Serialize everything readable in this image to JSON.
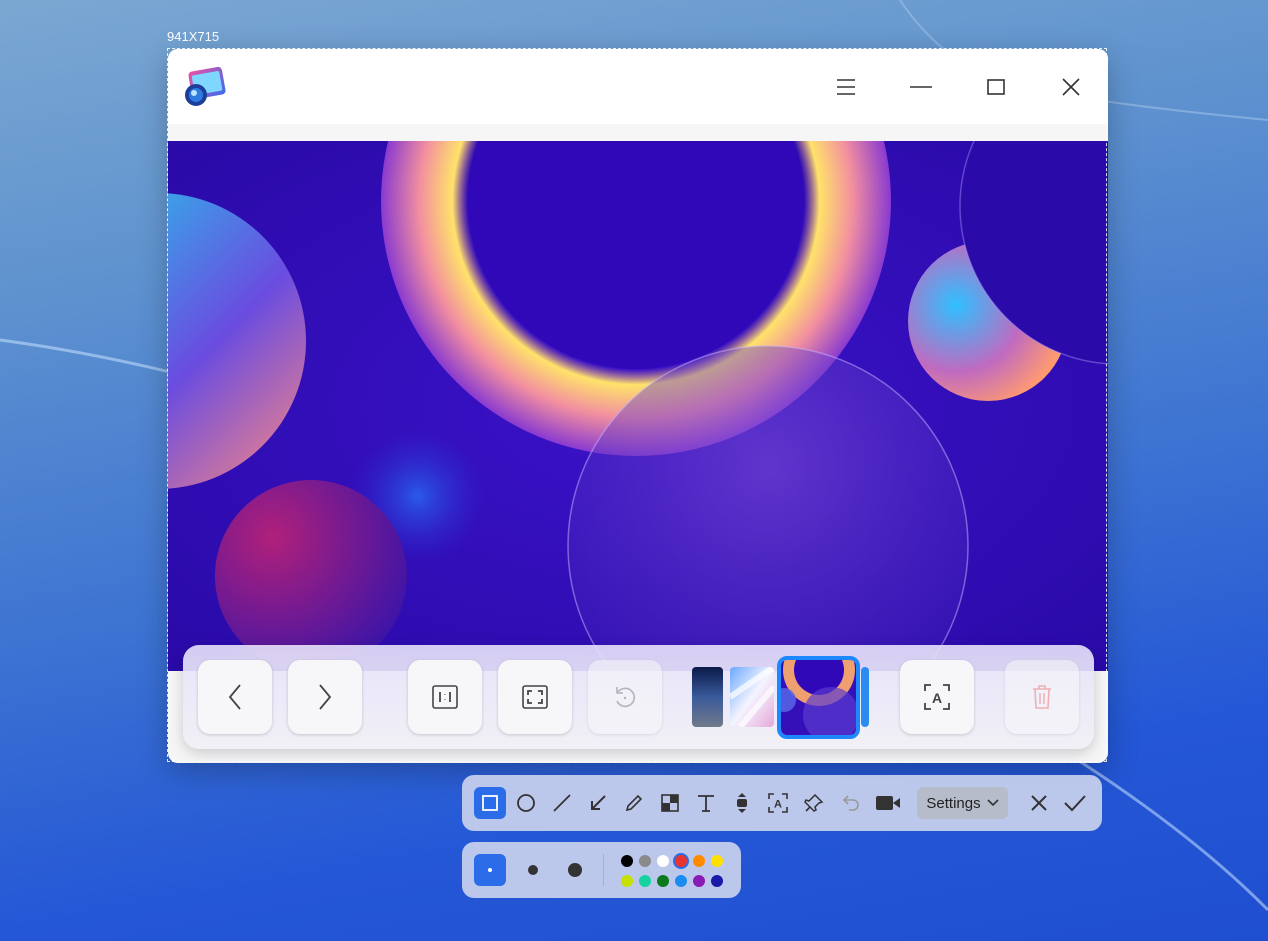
{
  "selection": {
    "size_label": "941X715"
  },
  "window": {
    "app_icon": "image-viewer-icon",
    "title_buttons": [
      "menu-icon",
      "minimize-icon",
      "maximize-icon",
      "close-icon"
    ]
  },
  "viewer_toolbar": {
    "buttons": [
      "previous-icon",
      "next-icon",
      "original-size-icon",
      "fit-window-icon",
      "rotate-icon",
      "ocr-icon",
      "delete-icon"
    ],
    "thumbnails": 4,
    "selected_thumbnail": 3
  },
  "screenshot_toolbar": {
    "tools": [
      "rectangle-icon",
      "ellipse-icon",
      "line-icon",
      "arrow-icon",
      "pen-icon",
      "mosaic-icon",
      "text-icon",
      "scroll-capture-icon",
      "ocr-icon",
      "pin-icon",
      "undo-icon",
      "record-icon"
    ],
    "active_tool": "rectangle-icon",
    "settings_label": "Settings",
    "cancel": "close-icon",
    "confirm": "check-icon"
  },
  "style_panel": {
    "sizes": [
      "small",
      "medium",
      "large"
    ],
    "active_size": "small",
    "colors": [
      "#000000",
      "#8a8a8a",
      "#ffffff",
      "#e8332f",
      "#ff8a00",
      "#ffe000",
      "#c6e000",
      "#16d1a0",
      "#0a7a1c",
      "#1a8cf0",
      "#8a1bb5",
      "#1a1aa8"
    ],
    "selected_color": "#e8332f"
  }
}
